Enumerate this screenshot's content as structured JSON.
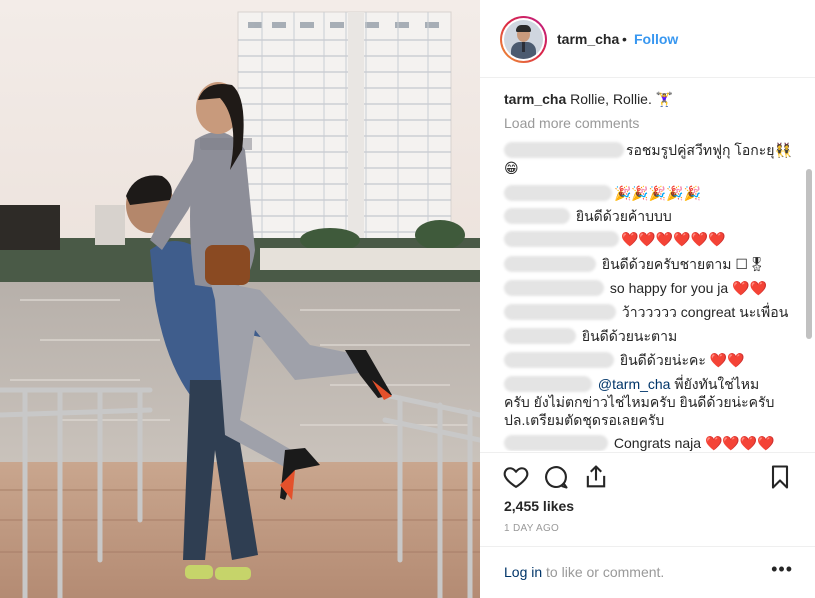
{
  "post": {
    "username": "tarm_cha",
    "separator": "•",
    "follow_label": "Follow",
    "caption_text": "Rollie, Rollie. 🏋️‍♀️",
    "load_more": "Load more comments",
    "likes": "2,455 likes",
    "time": "1 DAY AGO",
    "login_link": "Log in",
    "login_rest": " to like or comment.",
    "more": "•••"
  },
  "comments": [
    {
      "text": "รอชมรูปคู่สวีทฟูกุ โอกะยุ👯"
    },
    {
      "text": "😁"
    },
    {
      "text": "🎉🎉🎉🎉🎉"
    },
    {
      "text": "ยินดีด้วยค้าบบบ"
    },
    {
      "text": "❤️❤️❤️❤️❤️❤️"
    },
    {
      "text": "ยินดีด้วยครับชายตาม ☐🎖"
    },
    {
      "text": "so happy for you ja ❤️❤️"
    },
    {
      "text": "ว้าววววว congreat นะเพื่อน"
    },
    {
      "text": "ยินดีด้วยนะตาม"
    },
    {
      "text": "ยินดีด้วยน่ะคะ ❤️❤️"
    },
    {
      "mention": "@tarm_cha",
      "text": " พี่ยังทันใช่ไหม"
    },
    {
      "text": "ครับ ยังไม่ตกข่าวไช่ไหมครับ ยินดีด้วยน่ะครับ"
    },
    {
      "text": "ปล.เตรียมตัดชุดรอเลยครับ"
    },
    {
      "text": "Congrats naja ",
      "hearts": "❤️❤️❤️❤️"
    }
  ],
  "icons": {
    "heart": "heart-icon",
    "comment": "comment-icon",
    "share": "share-icon",
    "save": "bookmark-icon"
  }
}
